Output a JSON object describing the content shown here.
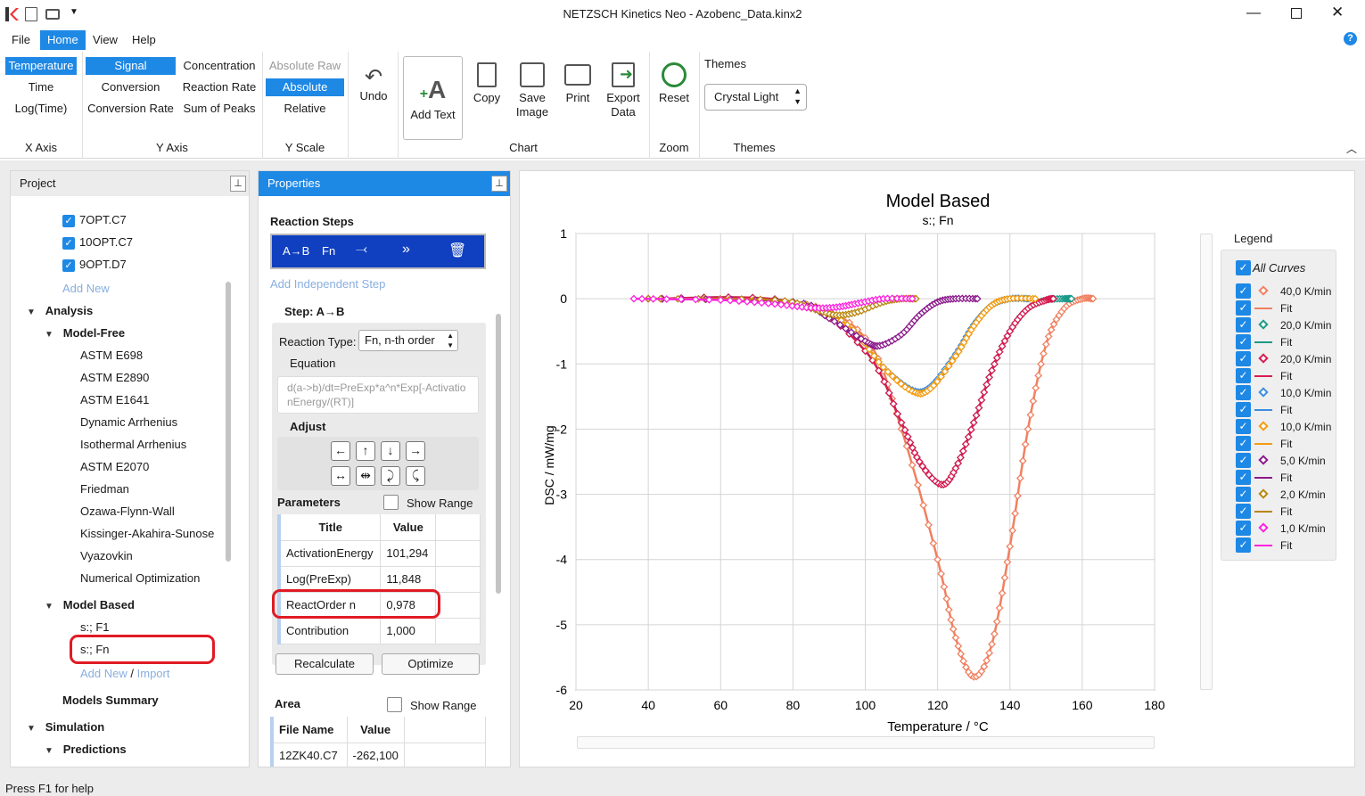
{
  "window": {
    "title": "NETZSCH Kinetics Neo - Azobenc_Data.kinx2"
  },
  "menu": [
    "File",
    "Home",
    "View",
    "Help"
  ],
  "ribbon": {
    "xaxis": {
      "items": [
        "Temperature",
        "Time",
        "Log(Time)"
      ],
      "group": "X Axis"
    },
    "yaxis": {
      "col1": [
        "Signal",
        "Conversion",
        "Conversion Rate"
      ],
      "col2": [
        "Concentration",
        "Reaction Rate",
        "Sum of Peaks"
      ],
      "group": "Y Axis"
    },
    "yscale": {
      "items": [
        "Absolute Raw",
        "Absolute",
        "Relative"
      ],
      "group": "Y Scale"
    },
    "undo": "Undo",
    "add_text": "Add Text",
    "copy": "Copy",
    "save_image": "Save Image",
    "print": "Print",
    "export_data": "Export Data",
    "chart_group": "Chart",
    "reset": "Reset",
    "zoom_group": "Zoom",
    "themes_label": "Themes",
    "theme_value": "Crystal Light",
    "themes_group": "Themes"
  },
  "project": {
    "title": "Project",
    "files": [
      "7OPT.C7",
      "10OPT.C7",
      "9OPT.D7"
    ],
    "add_new": "Add New",
    "analysis": "Analysis",
    "model_free": "Model-Free",
    "model_free_items": [
      "ASTM E698",
      "ASTM E2890",
      "ASTM E1641",
      "Dynamic Arrhenius",
      "Isothermal Arrhenius",
      "ASTM E2070",
      "Friedman",
      "Ozawa-Flynn-Wall",
      "Kissinger-Akahira-Sunose",
      "Vyazovkin",
      "Numerical Optimization"
    ],
    "model_based": "Model Based",
    "model_based_items": [
      "s:; F1",
      "s:; Fn"
    ],
    "add_new2": "Add New",
    "slash": "/",
    "import": "Import",
    "models_summary": "Models Summary",
    "simulation": "Simulation",
    "predictions": "Predictions"
  },
  "properties": {
    "title": "Properties",
    "reaction_steps": "Reaction Steps",
    "step_ab": "A→B",
    "step_fn": "Fn",
    "add_independent": "Add Independent Step",
    "step_label": "Step: A→B",
    "reaction_type_label": "Reaction Type:",
    "reaction_type_value": "Fn, n-th order",
    "equation_label": "Equation",
    "equation": "d(a->b)/dt=PreExp*a^n*Exp[-ActivationEnergy/(RT)]",
    "adjust": "Adjust",
    "parameters": "Parameters",
    "show_range": "Show Range",
    "col_title": "Title",
    "col_value": "Value",
    "params": [
      {
        "title": "ActivationEnergy",
        "value": "101,294"
      },
      {
        "title": "Log(PreExp)",
        "value": "11,848"
      },
      {
        "title": "ReactOrder n",
        "value": "0,978"
      },
      {
        "title": "Contribution",
        "value": "1,000"
      }
    ],
    "recalculate": "Recalculate",
    "optimize": "Optimize",
    "area": "Area",
    "show_range2": "Show Range",
    "col_file": "File Name",
    "col_value2": "Value",
    "area_rows": [
      {
        "file": "12ZK40.C7",
        "value": "-262,100"
      }
    ]
  },
  "chart": {
    "title": "Model Based",
    "subtitle": "s:; Fn",
    "xlabel": "Temperature / °C",
    "ylabel": "DSC / mW/mg",
    "x_ticks": [
      "20",
      "40",
      "60",
      "80",
      "100",
      "120",
      "140",
      "160",
      "180"
    ],
    "y_ticks": [
      "1",
      "0",
      "-1",
      "-2",
      "-3",
      "-4",
      "-5",
      "-6"
    ]
  },
  "chart_data": {
    "type": "line",
    "title": "Model Based",
    "subtitle": "s:; Fn",
    "xlabel": "Temperature / °C",
    "ylabel": "DSC / mW/mg",
    "xlim": [
      20,
      180
    ],
    "ylim": [
      -6,
      1
    ],
    "grid": true,
    "legend_position": "right",
    "series": [
      {
        "name": "40,0 K/min",
        "color": "#f08060",
        "marker": "diamond",
        "x": [
          40,
          80,
          100,
          110,
          120,
          125,
          130,
          135,
          140,
          145,
          150,
          155,
          160,
          163
        ],
        "y": [
          0,
          -0.05,
          -0.6,
          -2.0,
          -4.0,
          -5.2,
          -5.8,
          -5.3,
          -3.8,
          -2.0,
          -0.7,
          -0.15,
          0,
          0
        ]
      },
      {
        "name": "20,0 K/min",
        "color": "#1a9a8a",
        "marker": "diamond",
        "x": [
          40,
          80,
          100,
          110,
          115,
          121,
          125,
          130,
          135,
          140,
          145,
          150,
          155,
          157
        ],
        "y": [
          0,
          -0.05,
          -0.8,
          -1.9,
          -2.5,
          -2.85,
          -2.6,
          -1.9,
          -1.1,
          -0.5,
          -0.15,
          -0.02,
          0,
          0
        ]
      },
      {
        "name": "20,0 K/min",
        "color": "#d81b50",
        "marker": "diamond",
        "x": [
          40,
          80,
          100,
          110,
          115,
          121,
          125,
          130,
          135,
          140,
          145,
          150,
          152
        ],
        "y": [
          0,
          -0.05,
          -0.8,
          -1.9,
          -2.5,
          -2.85,
          -2.6,
          -1.9,
          -1.1,
          -0.5,
          -0.15,
          -0.02,
          0
        ]
      },
      {
        "name": "10,0 K/min",
        "color": "#3a8de0",
        "marker": "diamond",
        "x": [
          40,
          80,
          95,
          105,
          113,
          118,
          125,
          130,
          135,
          140,
          145
        ],
        "y": [
          0,
          -0.05,
          -0.4,
          -1.05,
          -1.4,
          -1.35,
          -0.85,
          -0.4,
          -0.1,
          0,
          0
        ]
      },
      {
        "name": "10,0 K/min",
        "color": "#f39c12",
        "marker": "diamond",
        "x": [
          40,
          80,
          95,
          105,
          113,
          118,
          125,
          130,
          135,
          140,
          147
        ],
        "y": [
          0,
          -0.05,
          -0.4,
          -1.05,
          -1.42,
          -1.38,
          -0.88,
          -0.42,
          -0.1,
          0,
          0
        ]
      },
      {
        "name": "5,0 K/min",
        "color": "#8b1a8b",
        "marker": "diamond",
        "x": [
          40,
          80,
          90,
          100,
          104,
          110,
          115,
          120,
          125,
          131
        ],
        "y": [
          0,
          -0.05,
          -0.3,
          -0.65,
          -0.72,
          -0.55,
          -0.25,
          -0.05,
          0,
          0
        ]
      },
      {
        "name": "2,0 K/min",
        "color": "#b8860b",
        "marker": "diamond",
        "x": [
          40,
          75,
          85,
          92,
          98,
          105,
          110,
          114
        ],
        "y": [
          0,
          -0.02,
          -0.15,
          -0.25,
          -0.2,
          -0.05,
          0,
          0
        ]
      },
      {
        "name": "1,0 K/min",
        "color": "#ff22dd",
        "marker": "diamond",
        "x": [
          36,
          60,
          75,
          85,
          92,
          98,
          105,
          113
        ],
        "y": [
          0,
          -0.02,
          -0.08,
          -0.14,
          -0.13,
          -0.07,
          0,
          0
        ]
      }
    ]
  },
  "legend": {
    "title": "Legend",
    "all": "All Curves",
    "items": [
      {
        "label": "40,0 K/min",
        "color": "#f08060",
        "kind": "marker"
      },
      {
        "label": "Fit",
        "color": "#f08060",
        "kind": "line"
      },
      {
        "label": "20,0 K/min",
        "color": "#1a9a8a",
        "kind": "marker"
      },
      {
        "label": "Fit",
        "color": "#1a9a8a",
        "kind": "line"
      },
      {
        "label": "20,0 K/min",
        "color": "#d81b50",
        "kind": "marker"
      },
      {
        "label": "Fit",
        "color": "#d81b50",
        "kind": "line"
      },
      {
        "label": "10,0 K/min",
        "color": "#3a8de0",
        "kind": "marker"
      },
      {
        "label": "Fit",
        "color": "#3a8de0",
        "kind": "line"
      },
      {
        "label": "10,0 K/min",
        "color": "#f39c12",
        "kind": "marker"
      },
      {
        "label": "Fit",
        "color": "#f39c12",
        "kind": "line"
      },
      {
        "label": "5,0 K/min",
        "color": "#8b1a8b",
        "kind": "marker"
      },
      {
        "label": "Fit",
        "color": "#8b1a8b",
        "kind": "line"
      },
      {
        "label": "2,0 K/min",
        "color": "#b8860b",
        "kind": "marker"
      },
      {
        "label": "Fit",
        "color": "#b8860b",
        "kind": "line"
      },
      {
        "label": "1,0 K/min",
        "color": "#ff22dd",
        "kind": "marker"
      },
      {
        "label": "Fit",
        "color": "#ff22dd",
        "kind": "line"
      }
    ]
  },
  "status": "Press F1 for help"
}
